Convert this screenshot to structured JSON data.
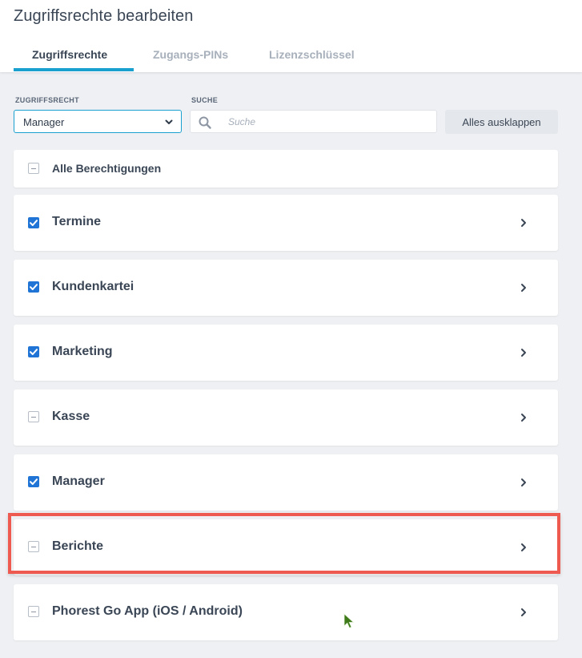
{
  "page_title": "Zugriffsrechte bearbeiten",
  "tabs": [
    {
      "label": "Zugriffsrechte",
      "active": true
    },
    {
      "label": "Zugangs-PINs",
      "active": false
    },
    {
      "label": "Lizenzschlüssel",
      "active": false
    }
  ],
  "filters": {
    "role_label": "ZUGRIFFSRECHT",
    "role_value": "Manager",
    "search_label": "SUCHE",
    "search_placeholder": "Suche",
    "search_value": "",
    "expand_all_label": "Alles ausklappen"
  },
  "all_permissions": {
    "label": "Alle Berechtigungen",
    "state": "partial"
  },
  "permission_groups": [
    {
      "label": "Termine",
      "state": "checked"
    },
    {
      "label": "Kundenkartei",
      "state": "checked"
    },
    {
      "label": "Marketing",
      "state": "checked"
    },
    {
      "label": "Kasse",
      "state": "partial"
    },
    {
      "label": "Manager",
      "state": "checked"
    },
    {
      "label": "Berichte",
      "state": "partial",
      "highlighted": true
    },
    {
      "label": "Phorest Go App (iOS / Android)",
      "state": "partial"
    }
  ],
  "colors": {
    "accent": "#1aa0cf",
    "checkbox": "#1f74d6",
    "highlight": "#ef5a50",
    "cursor": "#3f7a1a"
  },
  "icons": {
    "search": "search-icon",
    "dropdown": "chevron-down-icon",
    "row_expand": "chevron-right-icon",
    "pointer": "mouse-cursor-icon"
  }
}
